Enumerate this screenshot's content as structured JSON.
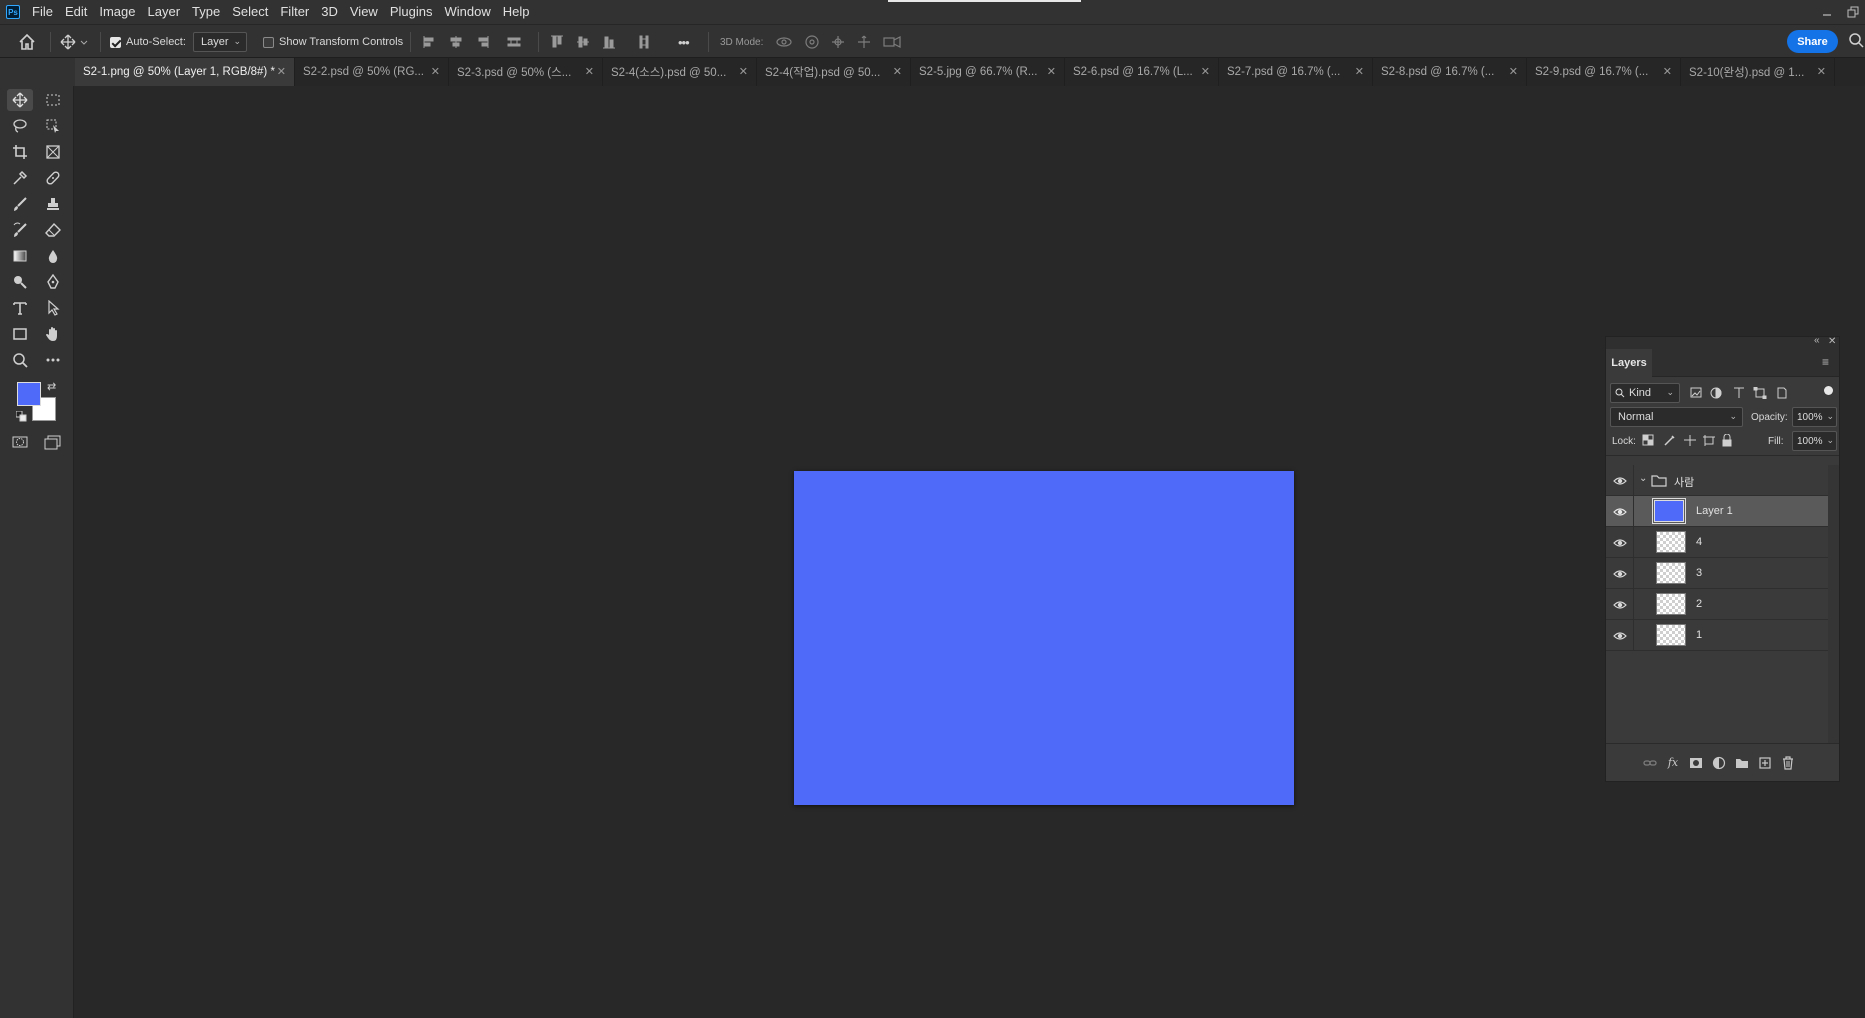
{
  "app": {
    "logo_text": "Ps"
  },
  "menu": [
    "File",
    "Edit",
    "Image",
    "Layer",
    "Type",
    "Select",
    "Filter",
    "3D",
    "View",
    "Plugins",
    "Window",
    "Help"
  ],
  "options": {
    "auto_select_label": "Auto-Select:",
    "auto_select_checked": true,
    "auto_select_target": "Layer",
    "show_transform_label": "Show Transform Controls",
    "show_transform_checked": false,
    "mode_3d_label": "3D Mode:",
    "more_label": "•••",
    "share_label": "Share"
  },
  "tabs": [
    {
      "label": "S2-1.png @ 50% (Layer 1, RGB/8#) *",
      "active": true
    },
    {
      "label": "S2-2.psd @ 50% (RG...",
      "active": false
    },
    {
      "label": "S2-3.psd @ 50% (스...",
      "active": false
    },
    {
      "label": "S2-4(소스).psd @ 50...",
      "active": false
    },
    {
      "label": "S2-4(작업).psd @ 50...",
      "active": false
    },
    {
      "label": "S2-5.jpg @ 66.7% (R...",
      "active": false
    },
    {
      "label": "S2-6.psd @ 16.7% (L...",
      "active": false
    },
    {
      "label": "S2-7.psd @ 16.7% (...",
      "active": false
    },
    {
      "label": "S2-8.psd @ 16.7% (...",
      "active": false
    },
    {
      "label": "S2-9.psd @ 16.7% (...",
      "active": false
    },
    {
      "label": "S2-10(완성).psd @ 1...",
      "active": false
    }
  ],
  "colors": {
    "foreground": "#4f69f8",
    "background": "#ffffff",
    "canvas_fill": "#4f69f8",
    "accent": "#1473e6"
  },
  "layers_panel": {
    "title": "Layers",
    "filter_kind": "Kind",
    "blend_mode": "Normal",
    "opacity_label": "Opacity:",
    "opacity_value": "100%",
    "lock_label": "Lock:",
    "fill_label": "Fill:",
    "fill_value": "100%",
    "group_name": "사람",
    "layers": [
      {
        "name": "Layer 1",
        "selected": true,
        "thumb": "blue-fill"
      },
      {
        "name": "4",
        "selected": false,
        "thumb": "transparent"
      },
      {
        "name": "3",
        "selected": false,
        "thumb": "transparent"
      },
      {
        "name": "2",
        "selected": false,
        "thumb": "transparent"
      },
      {
        "name": "1",
        "selected": false,
        "thumb": "transparent"
      }
    ]
  }
}
